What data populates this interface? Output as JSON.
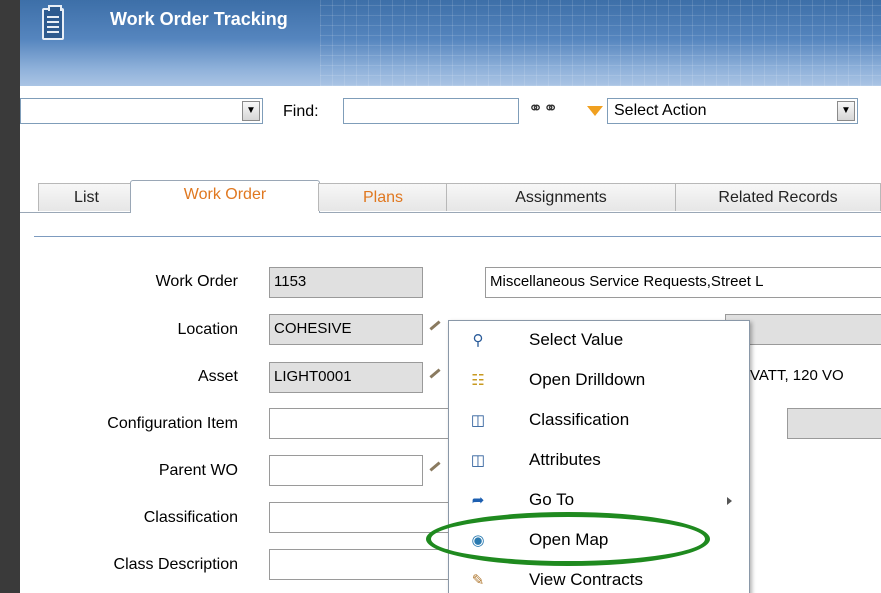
{
  "header": {
    "title": "Work Order Tracking",
    "app_icon": "clipboard-icon"
  },
  "toolbar": {
    "query_select_value": "",
    "find_label": "Find:",
    "find_value": "",
    "search_icon": "binoculars-icon",
    "action_icon": "orange-triangle-icon",
    "select_action_label": "Select Action"
  },
  "tabs": [
    {
      "label": "List"
    },
    {
      "label": "Work Order"
    },
    {
      "label": "Plans"
    },
    {
      "label": "Assignments"
    },
    {
      "label": "Related Records"
    }
  ],
  "form": {
    "work_order": {
      "label": "Work Order",
      "value": "1153",
      "description": "Miscellaneous Service Requests,Street L"
    },
    "location": {
      "label": "Location",
      "value": "COHESIVE"
    },
    "asset": {
      "label": "Asset",
      "value": "LIGHT0001",
      "description_partial": "VATT, 120 VO"
    },
    "configuration_item": {
      "label": "Configuration Item",
      "value": ""
    },
    "parent_wo": {
      "label": "Parent WO",
      "value": ""
    },
    "classification": {
      "label": "Classification",
      "value": ""
    },
    "class_description": {
      "label": "Class Description",
      "value": ""
    }
  },
  "context_menu": {
    "items": [
      {
        "label": "Select Value",
        "icon": "magnifier-icon"
      },
      {
        "label": "Open Drilldown",
        "icon": "hierarchy-icon"
      },
      {
        "label": "Classification",
        "icon": "book-icon"
      },
      {
        "label": "Attributes",
        "icon": "book-icon"
      },
      {
        "label": "Go To",
        "icon": "arrow-icon"
      },
      {
        "label": "Open Map",
        "icon": "globe-icon"
      },
      {
        "label": "View Contracts",
        "icon": "contract-icon"
      }
    ]
  },
  "colors": {
    "accent_tab": "#e07820",
    "highlight_ring": "#1f8a1f",
    "header_blue": "#3d6fa8"
  }
}
